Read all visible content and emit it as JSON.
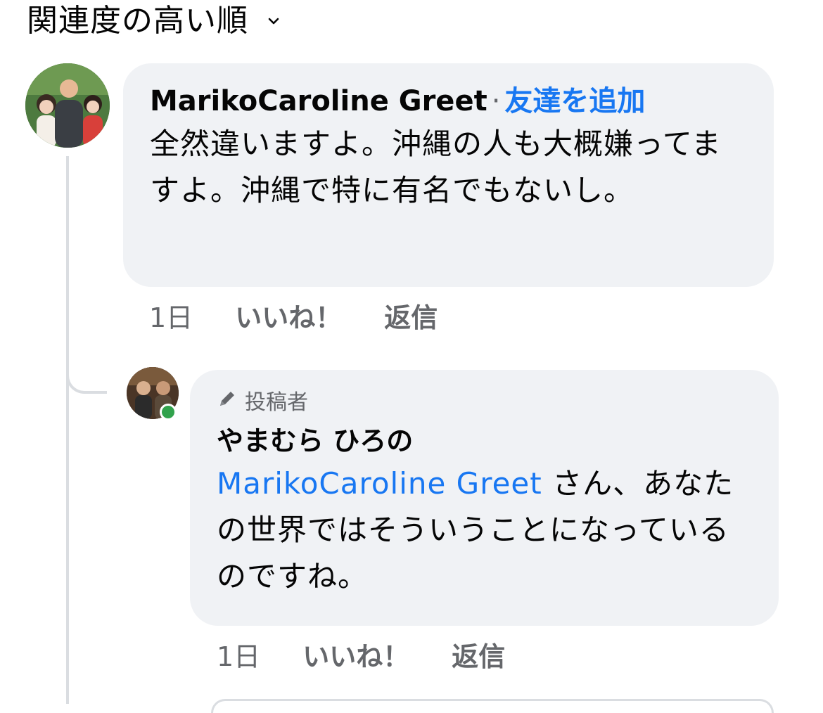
{
  "sort": {
    "label": "関連度の高い順",
    "icon": "chevron-down-icon"
  },
  "comments": [
    {
      "author": "MarikoCaroline Greet",
      "separator": "·",
      "add_friend": "友達を追加",
      "text": "全然違いますよ。沖縄の人も大概嫌ってますよ。沖縄で特に有名でもないし。",
      "time": "1日",
      "like": "いいね！",
      "reply": "返信"
    }
  ],
  "reply": {
    "badge": "投稿者",
    "badge_icon": "pencil-icon",
    "author": "やまむら ひろの",
    "mention": "MarikoCaroline Greet",
    "text": " さん、あなたの世界ではそういうことになっているのですね。",
    "time": "1日",
    "like": "いいね！",
    "reply": "返信",
    "online": true
  },
  "colors": {
    "link": "#1877f2",
    "bubble": "#f0f2f5",
    "secondary_text": "#65676b",
    "online": "#31a24c",
    "thread_line": "#dadde1"
  }
}
